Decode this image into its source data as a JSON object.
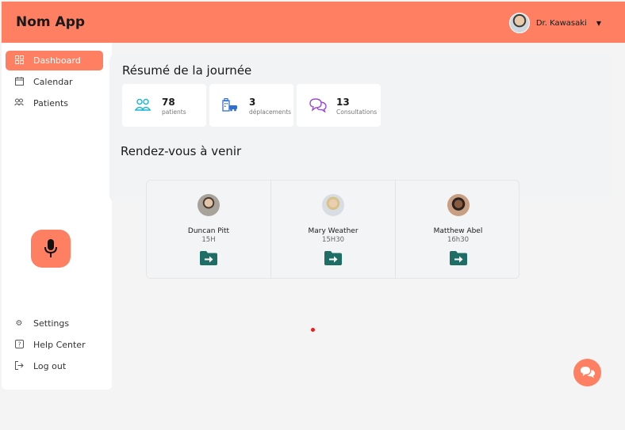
{
  "header": {
    "app_title": "Nom App",
    "user_name": "Dr. Kawasaki"
  },
  "sidebar": {
    "items": [
      {
        "label": "Dashboard",
        "icon": "grid-icon",
        "active": true
      },
      {
        "label": "Calendar",
        "icon": "calendar-icon",
        "active": false
      },
      {
        "label": "Patients",
        "icon": "users-icon",
        "active": false
      }
    ],
    "bottom_items": [
      {
        "label": "Settings",
        "icon": "gear-icon"
      },
      {
        "label": "Help Center",
        "icon": "help-icon"
      },
      {
        "label": "Log out",
        "icon": "logout-icon"
      }
    ]
  },
  "summary": {
    "title": "Résumé de la journée",
    "stats": [
      {
        "value": "78",
        "label": "patients",
        "icon": "people-icon",
        "color": "#1fb5d6"
      },
      {
        "value": "3",
        "label": "déplacements",
        "icon": "building-car-icon",
        "color": "#2f6fd0"
      },
      {
        "value": "13",
        "label": "Consultations",
        "icon": "chat-bubbles-icon",
        "color": "#9b4ad8"
      }
    ]
  },
  "upcoming": {
    "title": "Rendez-vous à venir",
    "appointments": [
      {
        "name": "Duncan Pitt",
        "time": "15H"
      },
      {
        "name": "Mary Weather",
        "time": "15H30"
      },
      {
        "name": "Matthew Abel",
        "time": "16h30"
      }
    ]
  },
  "colors": {
    "accent": "#ff7f62",
    "folder": "#1f6e66"
  }
}
